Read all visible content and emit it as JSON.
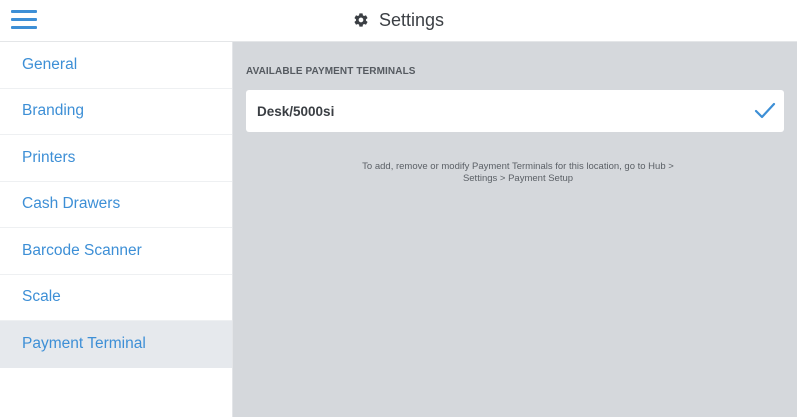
{
  "header": {
    "title": "Settings",
    "menu_icon": "hamburger-menu-icon",
    "title_icon": "gear-icon",
    "accent_color": "#3d8fd6"
  },
  "sidebar": {
    "items": [
      {
        "label": "General",
        "active": false
      },
      {
        "label": "Branding",
        "active": false
      },
      {
        "label": "Printers",
        "active": false
      },
      {
        "label": "Cash Drawers",
        "active": false
      },
      {
        "label": "Barcode Scanner",
        "active": false
      },
      {
        "label": "Scale",
        "active": false
      },
      {
        "label": "Payment Terminal",
        "active": true
      }
    ]
  },
  "main": {
    "section_label": "AVAILABLE PAYMENT TERMINALS",
    "terminals": [
      {
        "name": "Desk/5000si",
        "selected": true,
        "status_icon": "checkmark-icon"
      }
    ],
    "info_text_line1": "To add, remove or modify Payment Terminals for this location, go to Hub >",
    "info_text_line2": "Settings > Payment Setup"
  }
}
